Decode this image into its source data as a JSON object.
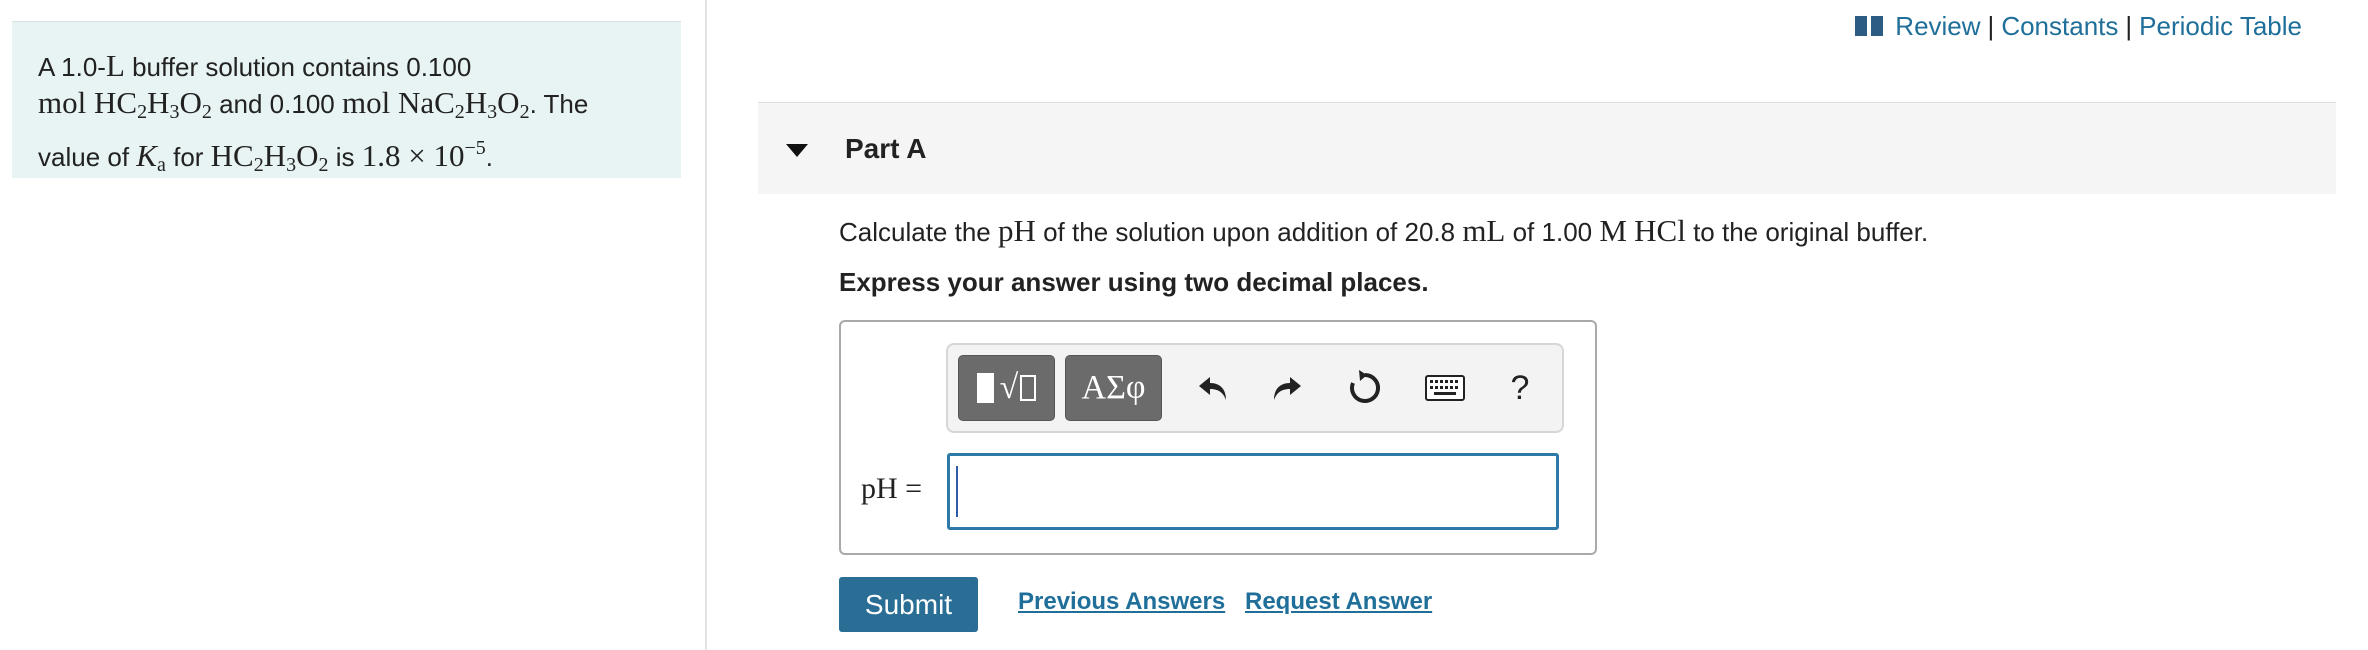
{
  "problem": {
    "line1_a": "A 1.0-",
    "line1_L": "L",
    "line1_b": " buffer solution contains 0.100",
    "mol": "mol",
    "acid": "HC",
    "and_text": " and 0.100 ",
    "salt": "NaC",
    "the_text": ". The",
    "value_of": "value of ",
    "ka_K": "K",
    "ka_sub": "a",
    "for_text": " for ",
    "is_text": " is ",
    "ka_value": "1.8 × 10",
    "ka_exp": "−5",
    "period": "."
  },
  "links": {
    "review": "Review",
    "constants": "Constants",
    "periodic_table": "Periodic Table",
    "separator": "|"
  },
  "part": {
    "title": "Part A"
  },
  "question": {
    "prefix": "Calculate the ",
    "pH": "pH",
    "mid1": " of the solution upon addition of 20.8 ",
    "mL": "mL",
    "mid2": " of 1.00 ",
    "M": "M",
    "HCl": "HCl",
    "suffix": " to the original buffer."
  },
  "instruction": "Express your answer using two decimal places.",
  "toolbar": {
    "greek_label": "ΑΣφ",
    "help_label": "?"
  },
  "answer": {
    "label": "pH =",
    "value": ""
  },
  "buttons": {
    "submit": "Submit",
    "previous_answers": "Previous Answers",
    "request_answer": "Request Answer"
  },
  "colors": {
    "panel_bg": "#e8f4f4",
    "link": "#1f6f9a",
    "submit_bg": "#2a6e96",
    "input_border": "#2d7aa9"
  }
}
